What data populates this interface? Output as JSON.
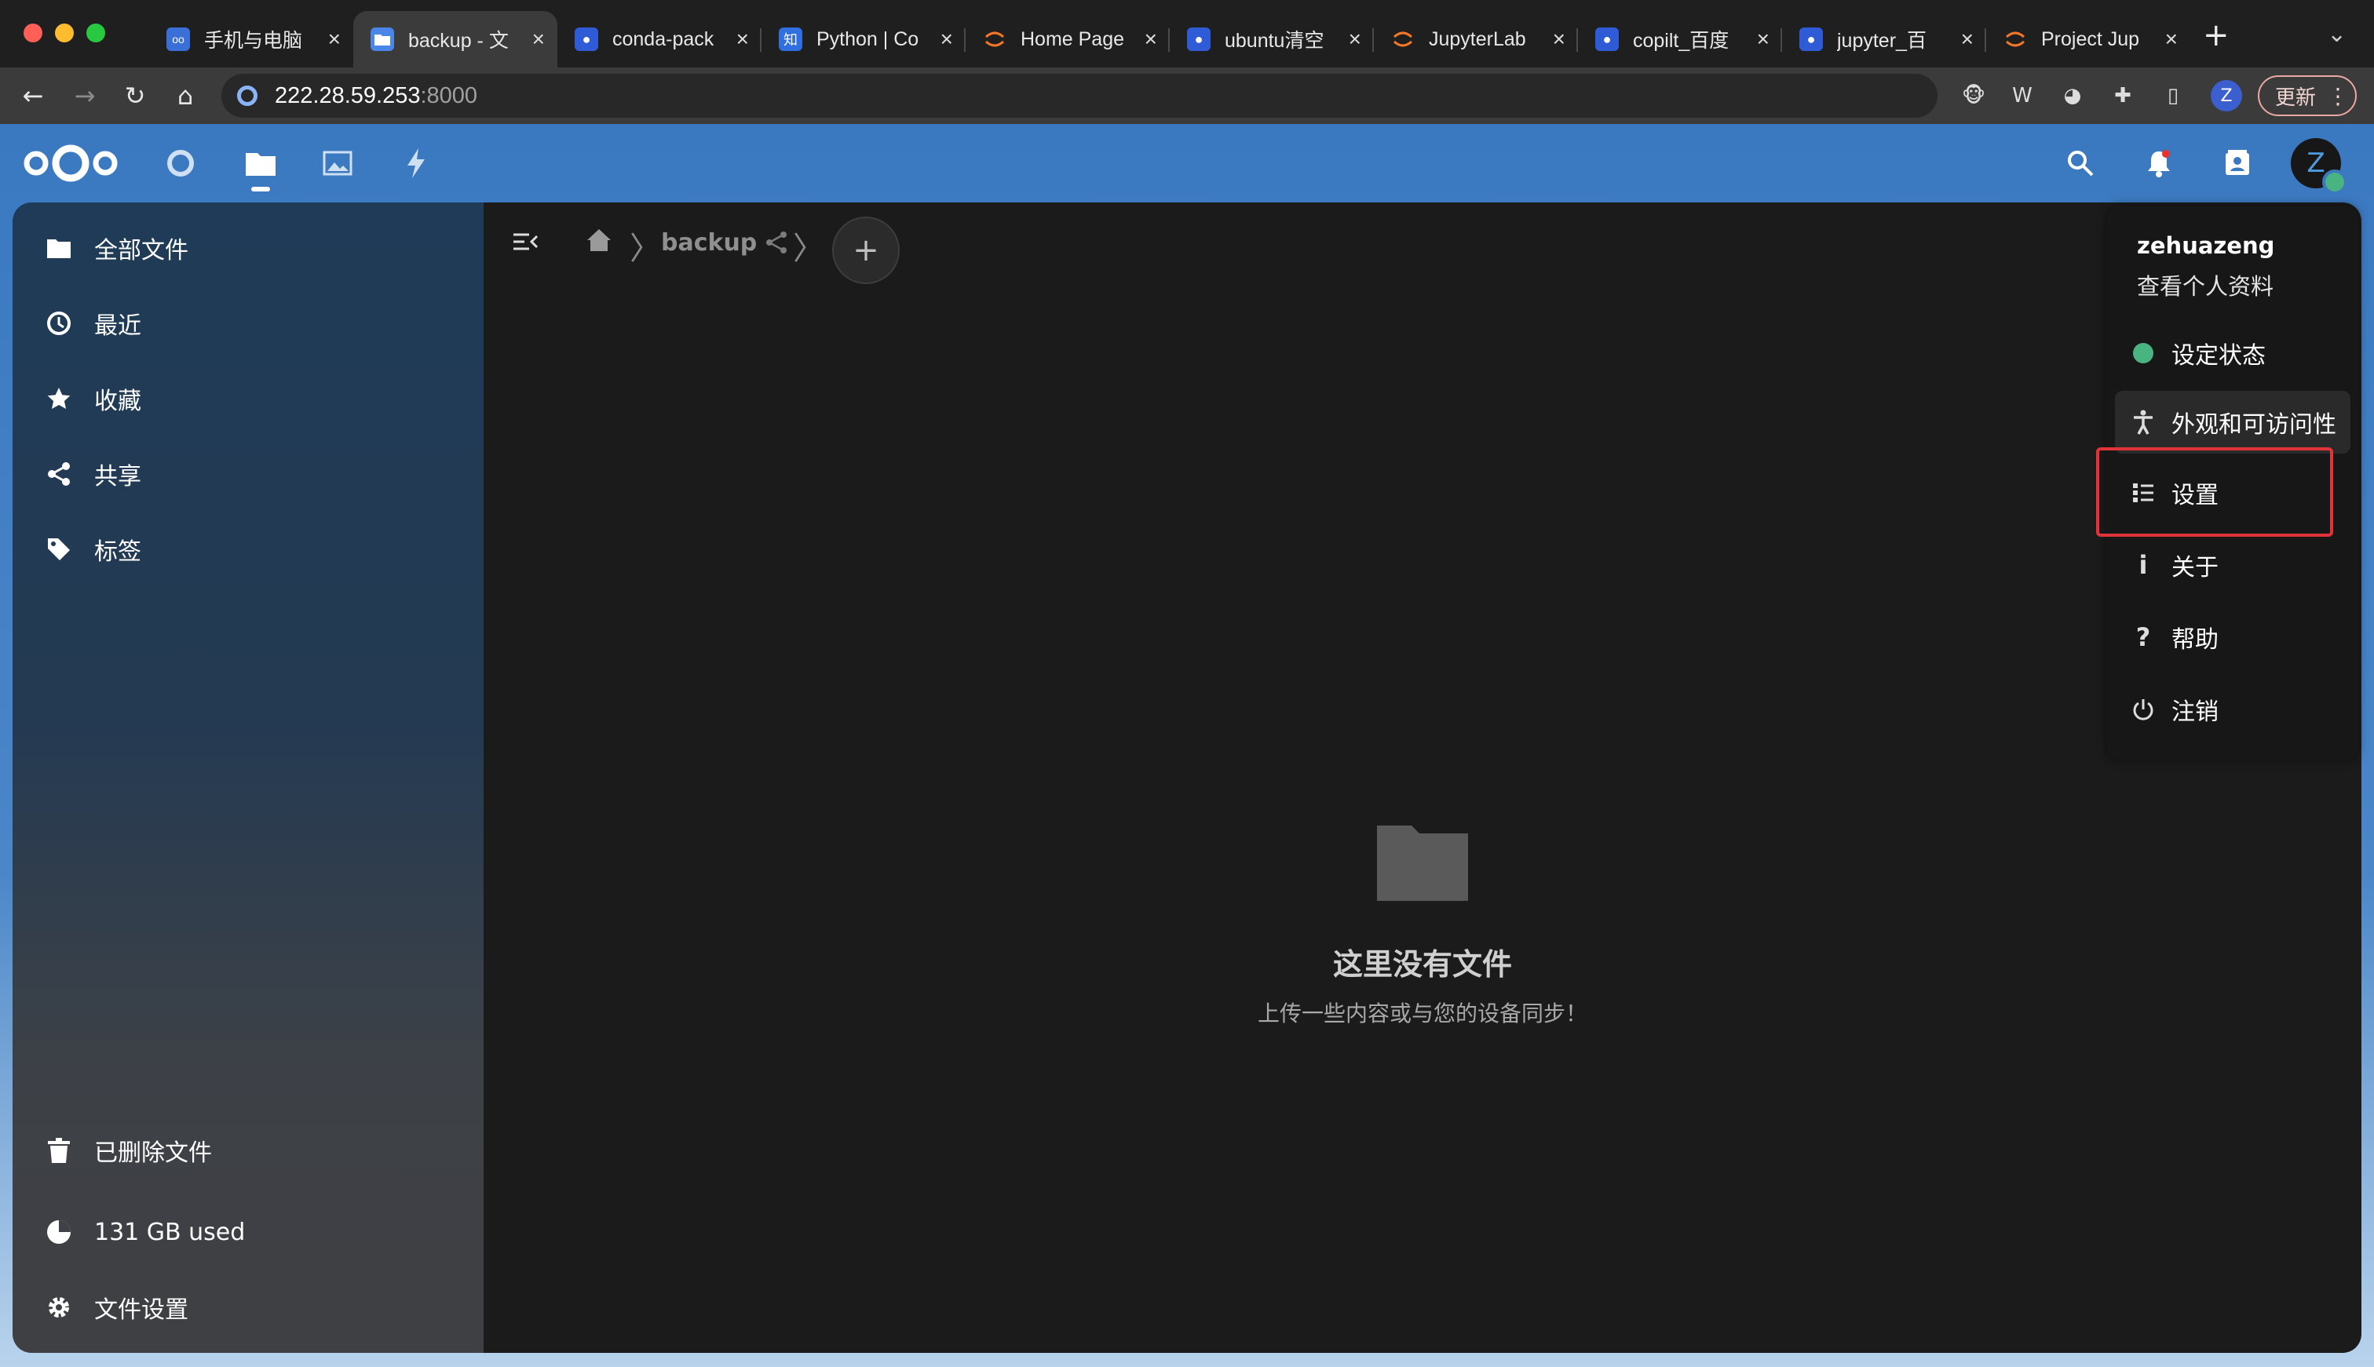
{
  "browser": {
    "tabs": [
      {
        "title": "手机与电脑",
        "favicon_color": "#3a6fd8",
        "favicon_glyph": "oo",
        "icon": "nextcloud-icon"
      },
      {
        "title": "backup - 文",
        "favicon_color": "#4a86e8",
        "favicon_glyph": "",
        "icon": "folder-icon"
      },
      {
        "title": "conda-pack",
        "favicon_color": "#2f5bd6",
        "favicon_glyph": "🐾",
        "icon": "baidu-icon"
      },
      {
        "title": "Python | Co",
        "favicon_color": "#2f6fe0",
        "favicon_glyph": "知",
        "icon": "zhihu-icon"
      },
      {
        "title": "Home Page",
        "favicon_color": "#f37726",
        "favicon_glyph": "",
        "icon": "jupyter-icon"
      },
      {
        "title": "ubuntu清空",
        "favicon_color": "#2f5bd6",
        "favicon_glyph": "🐾",
        "icon": "baidu-icon"
      },
      {
        "title": "JupyterLab",
        "favicon_color": "#f37726",
        "favicon_glyph": "",
        "icon": "jupyter-icon"
      },
      {
        "title": "copilt_百度",
        "favicon_color": "#2f5bd6",
        "favicon_glyph": "🐾",
        "icon": "baidu-icon"
      },
      {
        "title": "jupyter_百",
        "favicon_color": "#2f5bd6",
        "favicon_glyph": "🐾",
        "icon": "baidu-icon"
      },
      {
        "title": "Project Jup",
        "favicon_color": "#f37726",
        "favicon_glyph": "",
        "icon": "jupyter-icon"
      }
    ],
    "url_host": "222.28.59.253",
    "url_port": ":8000",
    "profile_initial": "Z",
    "update_label": "更新"
  },
  "sidebar": {
    "items": [
      {
        "label": "全部文件",
        "icon": "folder-icon"
      },
      {
        "label": "最近",
        "icon": "clock-icon"
      },
      {
        "label": "收藏",
        "icon": "star-icon"
      },
      {
        "label": "共享",
        "icon": "share-icon"
      },
      {
        "label": "标签",
        "icon": "tag-icon"
      }
    ],
    "footer": [
      {
        "label": "已删除文件",
        "icon": "trash-icon"
      },
      {
        "label": "131 GB used",
        "icon": "pie-chart-icon"
      },
      {
        "label": "文件设置",
        "icon": "gear-icon"
      }
    ]
  },
  "breadcrumb": {
    "folder": "backup"
  },
  "empty_state": {
    "title": "这里没有文件",
    "subtitle": "上传一些内容或与您的设备同步！"
  },
  "user": {
    "initial": "Z"
  },
  "user_menu": {
    "username": "zehuazeng",
    "profile_link": "查看个人资料",
    "status_label": "设定状态",
    "items": [
      {
        "label": "外观和可访问性",
        "icon": "accessibility-icon"
      },
      {
        "label": "设置",
        "icon": "settings-list-icon"
      },
      {
        "label": "关于",
        "icon": "info-icon"
      },
      {
        "label": "帮助",
        "icon": "help-icon"
      },
      {
        "label": "注销",
        "icon": "power-icon"
      }
    ]
  },
  "colors": {
    "header_blue": "#3a78c0",
    "status_green": "#49b382",
    "highlight_red": "#e0333a"
  }
}
